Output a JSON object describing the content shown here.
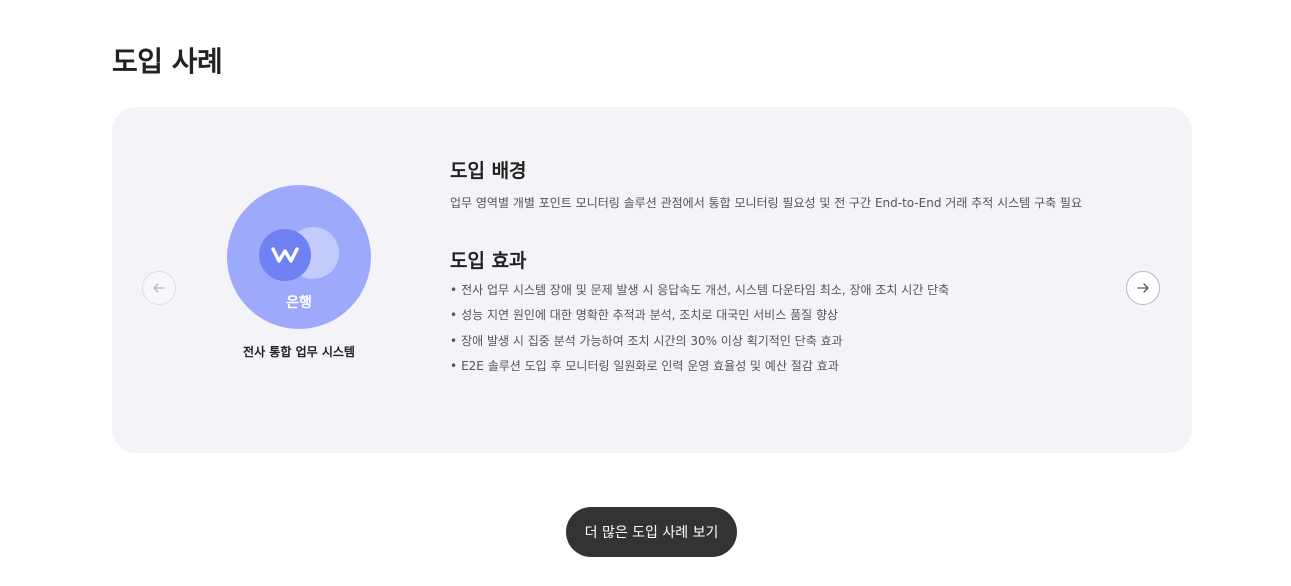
{
  "section": {
    "title": "도입 사례"
  },
  "case": {
    "client": {
      "name": "은행",
      "logo_letter": "W",
      "system": "전사 통합 업무 시스템"
    },
    "background": {
      "heading": "도입 배경",
      "text": "업무 영역별 개별 포인트 모니터링 솔루션 관점에서 통합 모니터링 필요성 및 전 구간 End-to-End 거래 추적 시스템 구축 필요"
    },
    "effect": {
      "heading": "도입 효과",
      "items": [
        "전사 업무 시스템 장애 및 문제 발생 시 응답속도 개선, 시스템 다운타임 최소, 장애 조치 시간 단축",
        "성능 지연 원인에 대한 명확한 추적과 분석, 조치로 대국민 서비스 품질 향상",
        "장애 발생 시 집중 분석 가능하여 조치 시간의 30% 이상 획기적인 단축 효과",
        "E2E 솔루션 도입 후 모니터링 일원화로 인력 운영 효율성 및 예산 절감 효과"
      ]
    }
  },
  "navigation": {
    "prev_icon": "arrow-left-icon",
    "next_icon": "arrow-right-icon"
  },
  "more_button": {
    "label": "더 많은 도입 사례 보기"
  },
  "colors": {
    "card_background": "#f4f4f8",
    "logo_background": "#9daafb",
    "logo_front": "#6f82f4",
    "logo_back": "#c2cbfc",
    "button_background": "#333333"
  }
}
